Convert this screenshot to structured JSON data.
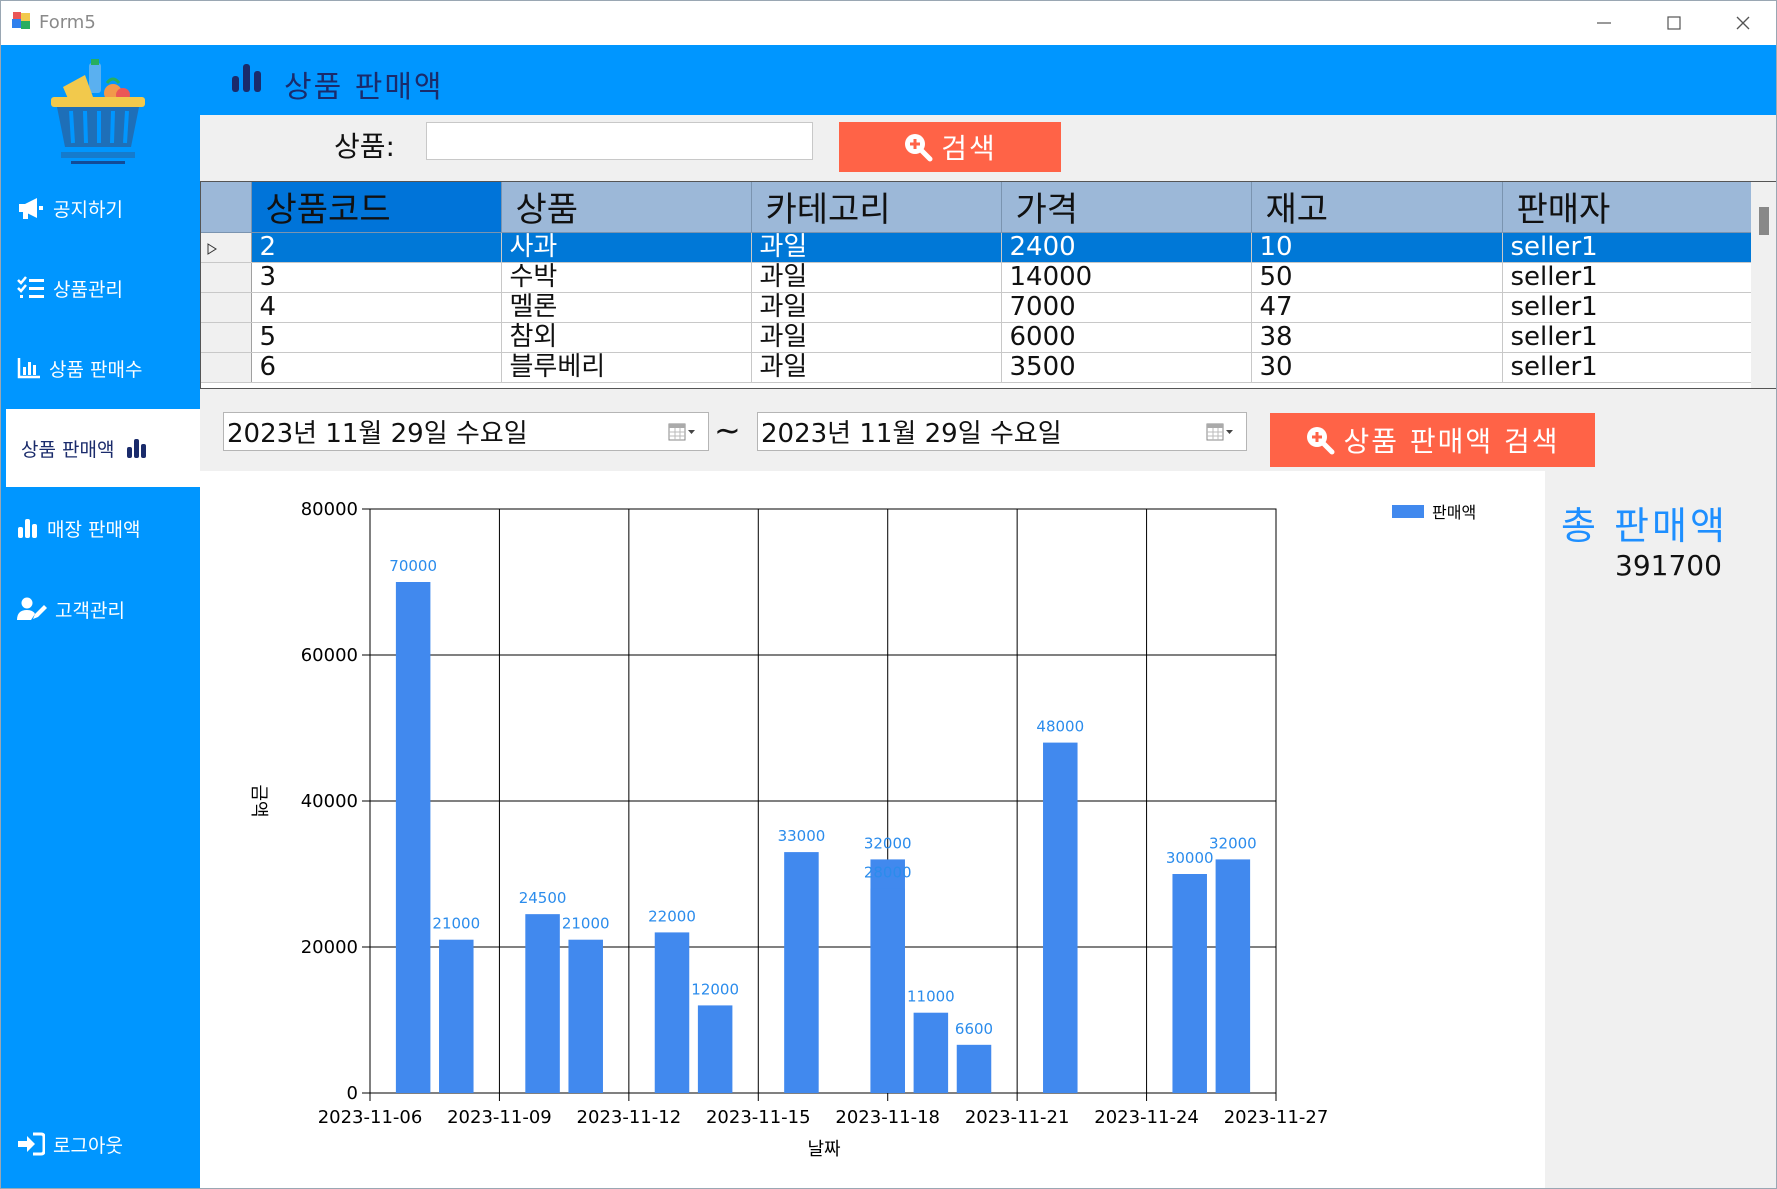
{
  "window": {
    "title": "Form5"
  },
  "sidebar": {
    "items": [
      {
        "label": "공지하기",
        "icon": "megaphone-icon"
      },
      {
        "label": "상품관리",
        "icon": "list-check-icon"
      },
      {
        "label": "상품 판매수",
        "icon": "bar-chart-icon"
      },
      {
        "label": "상품 판매액",
        "icon": "bar-chart-icon",
        "active": true
      },
      {
        "label": "매장 판매액",
        "icon": "bar-chart-icon"
      },
      {
        "label": "고객관리",
        "icon": "user-edit-icon"
      }
    ],
    "logout": {
      "label": "로그아웃",
      "icon": "logout-icon"
    }
  },
  "header": {
    "title": "상품 판매액"
  },
  "search": {
    "label": "상품:",
    "value": "",
    "button": "검색"
  },
  "table": {
    "columns": [
      "상품코드",
      "상품",
      "카테고리",
      "가격",
      "재고",
      "판매자"
    ],
    "rows": [
      [
        "2",
        "사과",
        "과일",
        "2400",
        "10",
        "seller1"
      ],
      [
        "3",
        "수박",
        "과일",
        "14000",
        "50",
        "seller1"
      ],
      [
        "4",
        "멜론",
        "과일",
        "7000",
        "47",
        "seller1"
      ],
      [
        "5",
        "참외",
        "과일",
        "6000",
        "38",
        "seller1"
      ],
      [
        "6",
        "블루베리",
        "과일",
        "3500",
        "30",
        "seller1"
      ]
    ],
    "selected_row": 0
  },
  "dates": {
    "from": "2023년 11월 29일 수요일",
    "to": "2023년 11월 29일 수요일",
    "separator": "~"
  },
  "sales_search_button": "상품 판매액 검색",
  "total": {
    "label": "총 판매액",
    "value": "391700"
  },
  "colors": {
    "accent": "#0096ff",
    "button": "#ff6347",
    "bar": "#4189ee",
    "selected_row": "#0078d7",
    "navy": "#1a2b6b"
  },
  "chart_data": {
    "type": "bar",
    "xlabel": "날짜",
    "ylabel": "금액",
    "legend": "판매액",
    "legend_position": "top-right",
    "ylim": [
      0,
      80000
    ],
    "yticks": [
      "0",
      "20000",
      "40000",
      "60000",
      "80000"
    ],
    "xticks": [
      "2023-11-06",
      "2023-11-09",
      "2023-11-12",
      "2023-11-15",
      "2023-11-18",
      "2023-11-21",
      "2023-11-24",
      "2023-11-27"
    ],
    "grid": true,
    "series": [
      {
        "name": "판매액",
        "points": [
          {
            "x": "2023-11-07",
            "y": 70000,
            "label": "70000"
          },
          {
            "x": "2023-11-08",
            "y": 21000,
            "label": "21000"
          },
          {
            "x": "2023-11-10",
            "y": 24500,
            "label": "24500"
          },
          {
            "x": "2023-11-11",
            "y": 21000,
            "label": "21000"
          },
          {
            "x": "2023-11-13",
            "y": 22000,
            "label": "22000"
          },
          {
            "x": "2023-11-14",
            "y": 12000,
            "label": "12000"
          },
          {
            "x": "2023-11-16",
            "y": 33000,
            "label": "33000"
          },
          {
            "x": "2023-11-18",
            "y": 32000,
            "label": "32000"
          },
          {
            "x": "2023-11-18",
            "y": 28000,
            "label": "28000"
          },
          {
            "x": "2023-11-19",
            "y": 11000,
            "label": "11000"
          },
          {
            "x": "2023-11-20",
            "y": 6600,
            "label": "6600"
          },
          {
            "x": "2023-11-22",
            "y": 48000,
            "label": "48000"
          },
          {
            "x": "2023-11-25",
            "y": 30000,
            "label": "30000"
          },
          {
            "x": "2023-11-26",
            "y": 32000,
            "label": "32000"
          }
        ]
      }
    ]
  }
}
